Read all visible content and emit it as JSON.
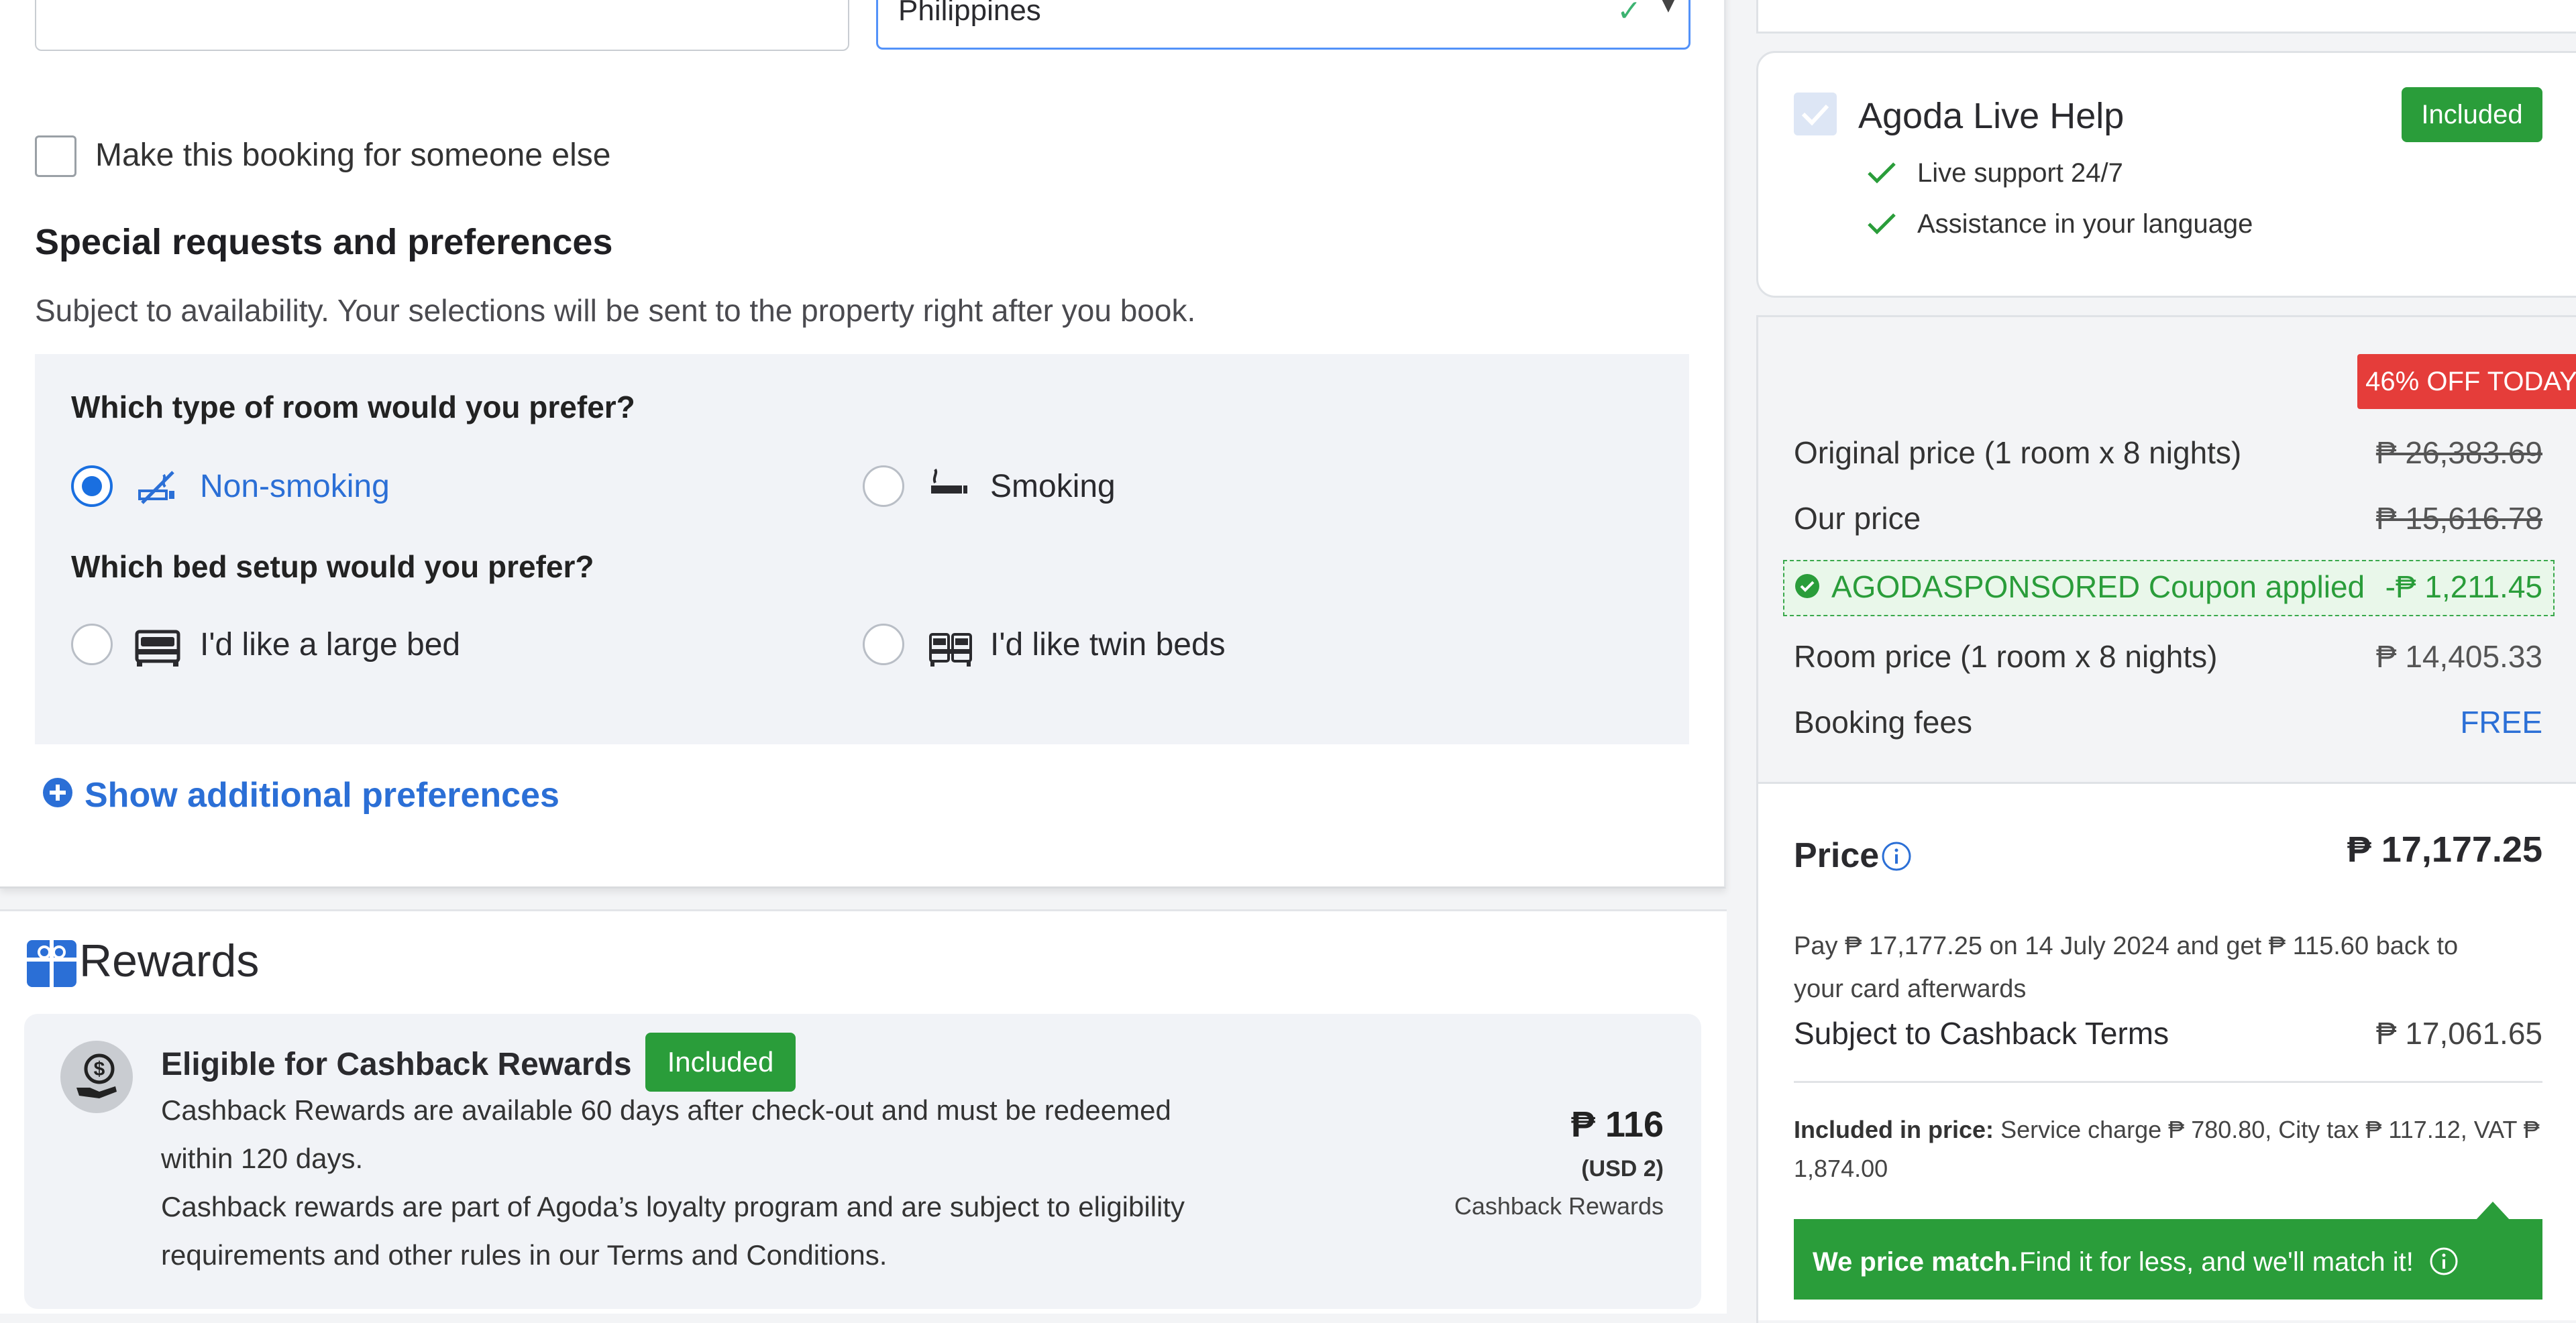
{
  "form": {
    "country_value": "Philippines",
    "someone_else_label": "Make this booking for someone else"
  },
  "special_requests": {
    "title": "Special requests and preferences",
    "subtitle": "Subject to availability. Your selections will be sent to the property right after you book.",
    "room_question": "Which type of room would you prefer?",
    "room_options": [
      {
        "label": "Non-smoking",
        "selected": true,
        "icon": "no-smoking-icon"
      },
      {
        "label": "Smoking",
        "selected": false,
        "icon": "smoking-icon"
      }
    ],
    "bed_question": "Which bed setup would you prefer?",
    "bed_options": [
      {
        "label": "I'd like a large bed",
        "selected": false,
        "icon": "large-bed-icon"
      },
      {
        "label": "I'd like twin beds",
        "selected": false,
        "icon": "twin-beds-icon"
      }
    ],
    "show_more_label": "Show additional preferences"
  },
  "rewards": {
    "title": "Rewards",
    "cashback_title": "Eligible for Cashback Rewards",
    "cashback_badge": "Included",
    "desc_line1": "Cashback Rewards are available 60 days after check-out and must be redeemed",
    "desc_line2": "within 120 days.",
    "desc_line3": "Cashback rewards are part of Agoda’s loyalty program and are subject to eligibility",
    "desc_line4": "requirements and other rules in our Terms and Conditions.",
    "amount": "₱ 116",
    "amount_usd": "(USD 2)",
    "amount_label": "Cashback Rewards"
  },
  "live_help": {
    "title": "Agoda Live Help",
    "badge": "Included",
    "features": [
      "Live support 24/7",
      "Assistance in your language"
    ]
  },
  "pricing": {
    "discount_badge": "46% OFF TODAY",
    "original_label": "Original price (1 room x 8 nights)",
    "original_value": "₱ 26,383.69",
    "our_label": "Our price",
    "our_value": "₱ 15,616.78",
    "coupon_label": "AGODASPONSORED Coupon applied",
    "coupon_value": "-₱ 1,211.45",
    "room_label": "Room price (1 room x 8 nights)",
    "room_value": "₱ 14,405.33",
    "fees_label": "Booking fees",
    "fees_value": "FREE",
    "price_label": "Price",
    "price_value": "₱ 17,177.25",
    "pay_line1": "Pay ₱ 17,177.25 on 14 July 2024 and get ₱ 115.60 back to",
    "pay_line2": "your card afterwards",
    "cashback_terms_label": "Subject to Cashback Terms",
    "cashback_terms_value": "₱ 17,061.65",
    "included_bold": "Included in price:",
    "included_line1": "Service charge ₱ 780.80, City tax ₱ 117.12, VAT ₱",
    "included_line2": "1,874.00",
    "price_match_bold": "We price match.",
    "price_match_text": "Find it for less, and we'll match it!"
  },
  "colors": {
    "accent_blue": "#1a6fe0",
    "link_blue": "#2b6fd6",
    "green": "#2a9d3a",
    "red_badge": "#e53d3a"
  }
}
